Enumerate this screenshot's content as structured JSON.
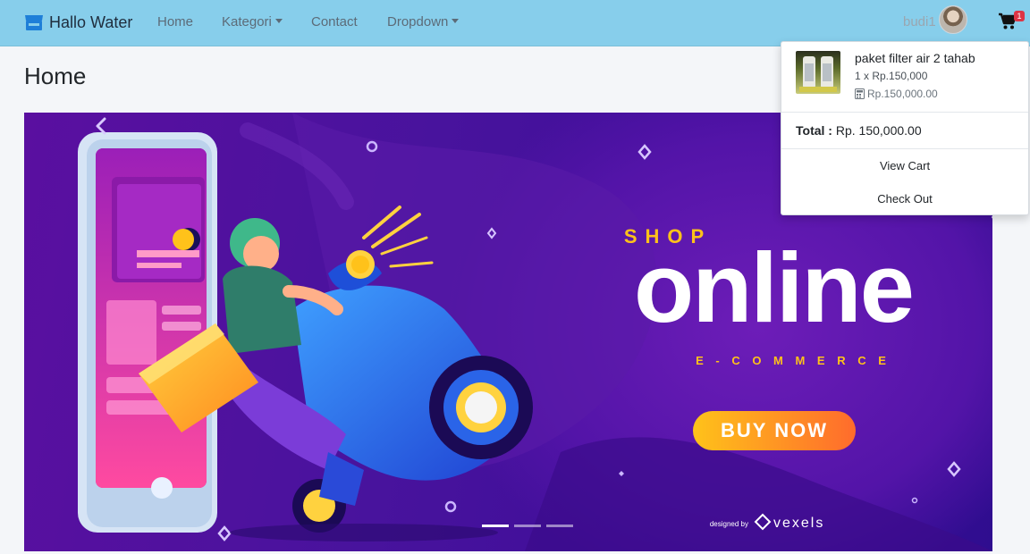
{
  "navbar": {
    "brand": "Hallo Water",
    "links": [
      "Home",
      "Kategori",
      "Contact",
      "Dropdown"
    ],
    "user_name": "budi1",
    "cart_count": "1"
  },
  "page": {
    "title": "Home"
  },
  "banner": {
    "shop": "SHOP",
    "online": "online",
    "ecommerce": "E - C O M M E R C E",
    "buy_now": "BUY NOW",
    "designed_by": "designed by",
    "vexels": "vexels"
  },
  "cart": {
    "item_name": "paket filter air 2 tahab",
    "item_qty": "1 x Rp.150,000",
    "item_subtotal": "Rp.150,000.00",
    "total_label": "Total :",
    "total_value": "Rp. 150,000.00",
    "view_cart": "View Cart",
    "check_out": "Check Out"
  },
  "colors": {
    "navbar": "#87ceeb",
    "banner": "#4a12a0",
    "accent_yellow": "#f5c518",
    "badge": "#dc3545"
  }
}
